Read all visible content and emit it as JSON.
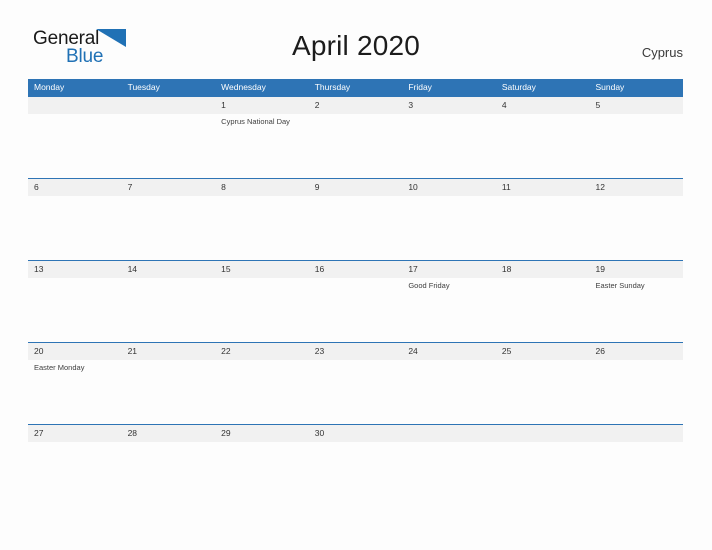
{
  "brand": {
    "name_part1": "General",
    "name_part2": "Blue",
    "flag_icon": "flag-triangle-icon",
    "accent_color": "#2071b5"
  },
  "header": {
    "title": "April 2020",
    "country": "Cyprus"
  },
  "colors": {
    "header_blue": "#2e74b5",
    "row_band_gray": "#f1f1f1",
    "page_background": "#fdfdfd",
    "day_number_text": "#333333",
    "event_text": "#3f3f3f"
  },
  "calendar": {
    "month": "April",
    "year": "2020",
    "weekday_headers": [
      "Monday",
      "Tuesday",
      "Wednesday",
      "Thursday",
      "Friday",
      "Saturday",
      "Sunday"
    ],
    "weeks": [
      {
        "days": [
          {
            "number": "",
            "event": ""
          },
          {
            "number": "",
            "event": ""
          },
          {
            "number": "1",
            "event": "Cyprus National Day"
          },
          {
            "number": "2",
            "event": ""
          },
          {
            "number": "3",
            "event": ""
          },
          {
            "number": "4",
            "event": ""
          },
          {
            "number": "5",
            "event": ""
          }
        ]
      },
      {
        "days": [
          {
            "number": "6",
            "event": ""
          },
          {
            "number": "7",
            "event": ""
          },
          {
            "number": "8",
            "event": ""
          },
          {
            "number": "9",
            "event": ""
          },
          {
            "number": "10",
            "event": ""
          },
          {
            "number": "11",
            "event": ""
          },
          {
            "number": "12",
            "event": ""
          }
        ]
      },
      {
        "days": [
          {
            "number": "13",
            "event": ""
          },
          {
            "number": "14",
            "event": ""
          },
          {
            "number": "15",
            "event": ""
          },
          {
            "number": "16",
            "event": ""
          },
          {
            "number": "17",
            "event": "Good Friday"
          },
          {
            "number": "18",
            "event": ""
          },
          {
            "number": "19",
            "event": "Easter Sunday"
          }
        ]
      },
      {
        "days": [
          {
            "number": "20",
            "event": "Easter Monday"
          },
          {
            "number": "21",
            "event": ""
          },
          {
            "number": "22",
            "event": ""
          },
          {
            "number": "23",
            "event": ""
          },
          {
            "number": "24",
            "event": ""
          },
          {
            "number": "25",
            "event": ""
          },
          {
            "number": "26",
            "event": ""
          }
        ]
      },
      {
        "days": [
          {
            "number": "27",
            "event": ""
          },
          {
            "number": "28",
            "event": ""
          },
          {
            "number": "29",
            "event": ""
          },
          {
            "number": "30",
            "event": ""
          },
          {
            "number": "",
            "event": ""
          },
          {
            "number": "",
            "event": ""
          },
          {
            "number": "",
            "event": ""
          }
        ]
      }
    ]
  }
}
